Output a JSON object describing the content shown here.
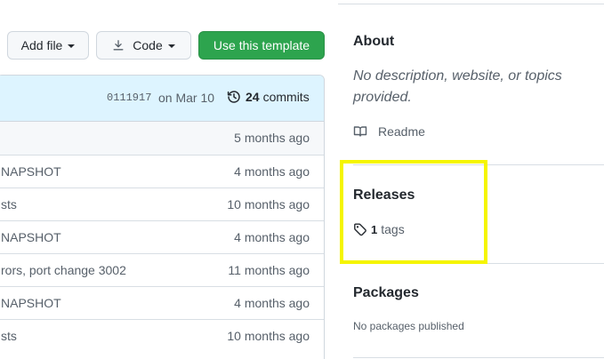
{
  "toolbar": {
    "add_file_label": "Add file",
    "code_label": "Code",
    "use_template_label": "Use this template"
  },
  "latest_commit": {
    "sha": "0111917",
    "date": "on Mar 10",
    "commit_count": "24",
    "commit_label": "commits"
  },
  "files": [
    {
      "message": "",
      "age": "5 months ago"
    },
    {
      "message": "NAPSHOT",
      "age": "4 months ago"
    },
    {
      "message": "sts",
      "age": "10 months ago"
    },
    {
      "message": "NAPSHOT",
      "age": "4 months ago"
    },
    {
      "message": "rors, port change 3002",
      "age": "11 months ago"
    },
    {
      "message": "NAPSHOT",
      "age": "4 months ago"
    },
    {
      "message": "sts",
      "age": "10 months ago"
    }
  ],
  "about": {
    "title": "About",
    "description": "No description, website, or topics provided.",
    "readme_label": "Readme"
  },
  "releases": {
    "title": "Releases",
    "tag_count": "1",
    "tag_label": "tags"
  },
  "packages": {
    "title": "Packages",
    "empty_text": "No packages published"
  },
  "colors": {
    "primary_button": "#2da44e",
    "commit_header_bg": "#ddf4ff",
    "highlight_outline": "#f5f500"
  }
}
